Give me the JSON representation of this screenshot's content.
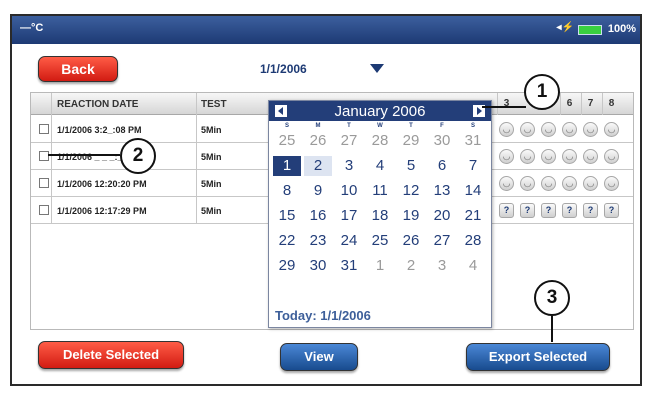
{
  "status": {
    "temp": "—°C",
    "battery": "100%"
  },
  "toolbar": {
    "back": "Back",
    "date_value": "1/1/2006",
    "delete": "Delete Selected",
    "view": "View",
    "export": "Export Selected"
  },
  "table": {
    "headers": [
      "REACTION DATE",
      "TEST"
    ],
    "rows": [
      {
        "date": "1/1/2006 3:2_:08 PM",
        "test": "5Min"
      },
      {
        "date": "1/1/2006 _ _ _:_2 PM",
        "test": "5Min"
      },
      {
        "date": "1/1/2006 12:20:20 PM",
        "test": "5Min"
      },
      {
        "date": "1/1/2006 12:17:29 PM",
        "test": "5Min"
      }
    ],
    "result_headers": [
      "3",
      "6",
      "7",
      "8"
    ],
    "q_symbol": "?",
    "face_symbol": "◡"
  },
  "calendar": {
    "title": "January 2006",
    "weekdays": [
      "S",
      "M",
      "T",
      "W",
      "T",
      "F",
      "S"
    ],
    "weeks": [
      [
        "25",
        "26",
        "27",
        "28",
        "29",
        "30",
        "31"
      ],
      [
        "1",
        "2",
        "3",
        "4",
        "5",
        "6",
        "7"
      ],
      [
        "8",
        "9",
        "10",
        "11",
        "12",
        "13",
        "14"
      ],
      [
        "15",
        "16",
        "17",
        "18",
        "19",
        "20",
        "21"
      ],
      [
        "22",
        "23",
        "24",
        "25",
        "26",
        "27",
        "28"
      ],
      [
        "29",
        "30",
        "31",
        "1",
        "2",
        "3",
        "4"
      ]
    ],
    "selected": "1",
    "today_label": "Today: 1/1/2006"
  },
  "callouts": [
    "1",
    "2",
    "3"
  ]
}
